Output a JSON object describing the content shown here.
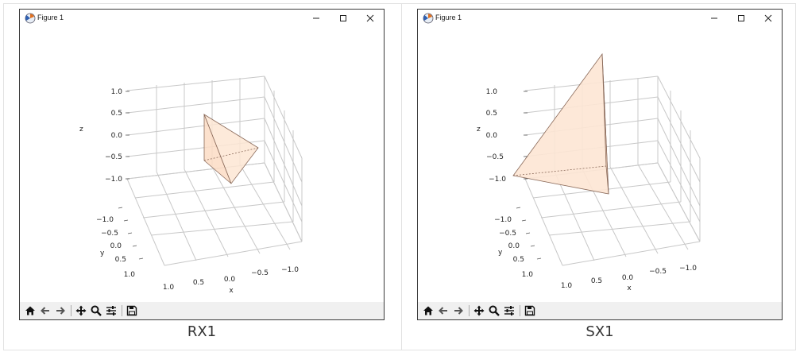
{
  "figures": [
    {
      "window_title": "Figure 1",
      "caption": "RX1",
      "z_ticks": [
        "1.0",
        "0.5",
        "0.0",
        "−0.5",
        "−1.0"
      ],
      "y_ticks": [
        "−1.0",
        "−0.5",
        "0.0",
        "0.5",
        "1.0"
      ],
      "x_ticks": [
        "1.0",
        "0.5",
        "0.0",
        "−0.5",
        "−1.0"
      ],
      "axis_labels": {
        "x": "x",
        "y": "y",
        "z": "z"
      }
    },
    {
      "window_title": "Figure 1",
      "caption": "SX1",
      "z_ticks": [
        "1.0",
        "0.5",
        "0.0",
        "−0.5",
        "−1.0"
      ],
      "y_ticks": [
        "−1.0",
        "−0.5",
        "0.0",
        "0.5",
        "1.0"
      ],
      "x_ticks": [
        "1.0",
        "0.5",
        "0.0",
        "−0.5",
        "−1.0"
      ],
      "axis_labels": {
        "x": "x",
        "y": "y",
        "z": "z"
      }
    }
  ],
  "toolbar_icons": [
    "home-icon",
    "back-arrow-icon",
    "forward-arrow-icon",
    "pan-icon",
    "zoom-icon",
    "configure-subplots-icon",
    "save-icon"
  ],
  "window_controls": [
    "minimize-icon",
    "maximize-icon",
    "close-icon"
  ],
  "colors": {
    "face": "#fde6d4",
    "edge": "#8a6a5a",
    "grid": "#c8c8c8",
    "toolbar": "#f0f0f0"
  }
}
